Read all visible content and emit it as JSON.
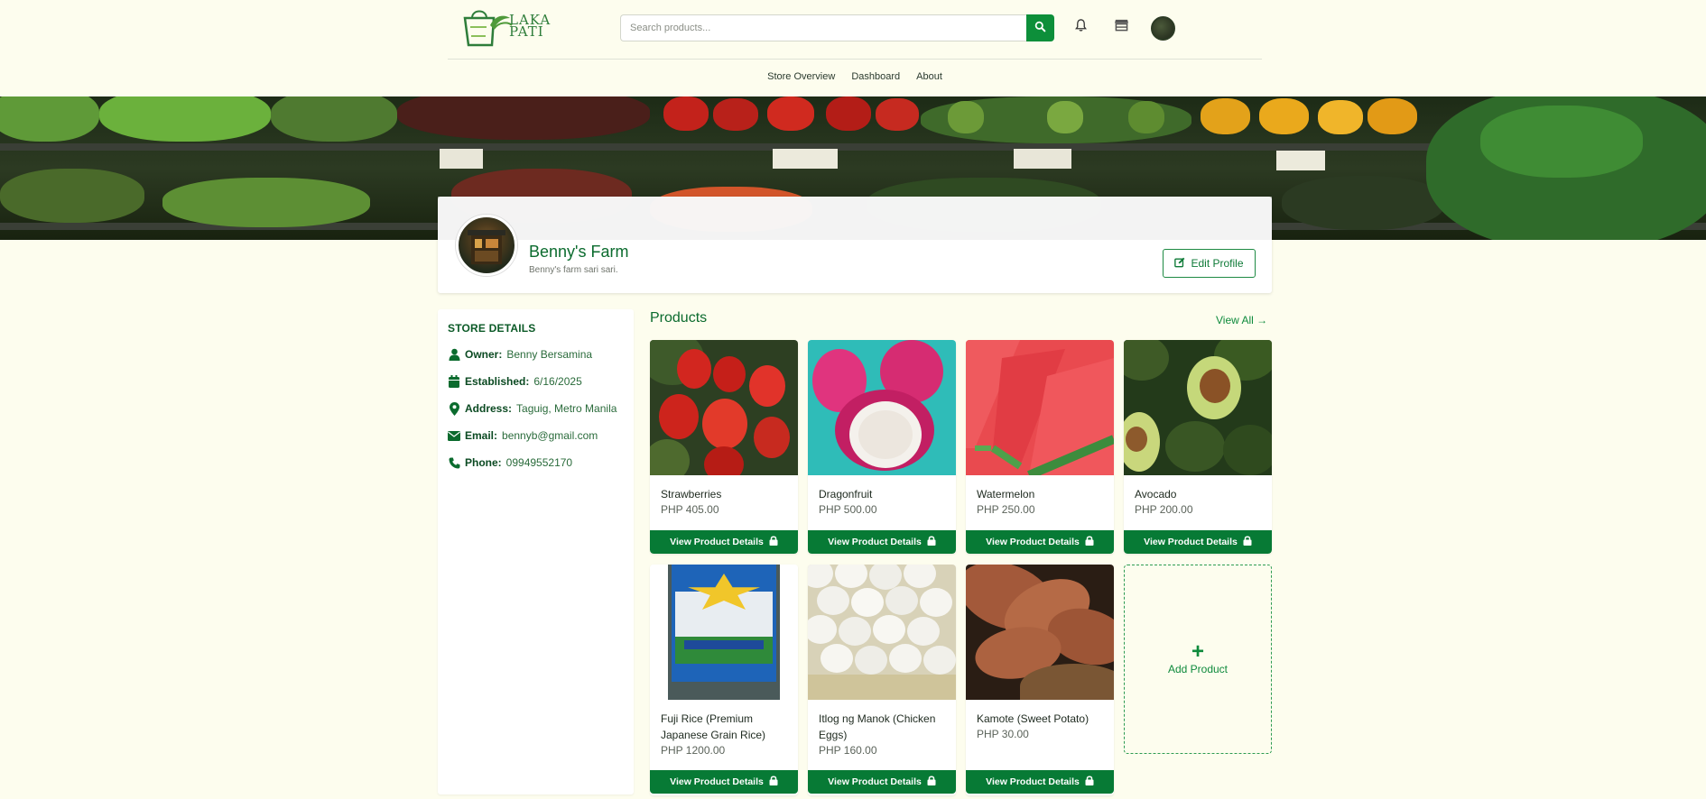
{
  "header": {
    "logo_text_line1": "LAKA",
    "logo_text_line2": "PATI",
    "search_placeholder": "Search products...",
    "icons": [
      "search-icon",
      "bell-icon",
      "store-icon",
      "avatar"
    ]
  },
  "nav": {
    "items": [
      "Store Overview",
      "Dashboard",
      "About"
    ]
  },
  "profile": {
    "store_name": "Benny's Farm",
    "description": "Benny's farm sari sari.",
    "edit_label": "Edit Profile"
  },
  "store_details": {
    "title": "STORE DETAILS",
    "rows": [
      {
        "label": "Owner:",
        "value": "Benny Bersamina",
        "icon": "user-icon"
      },
      {
        "label": "Established:",
        "value": "6/16/2025",
        "icon": "calendar-icon"
      },
      {
        "label": "Address:",
        "value": "Taguig, Metro Manila",
        "icon": "location-pin-icon"
      },
      {
        "label": "Email:",
        "value": "bennyb@gmail.com",
        "icon": "envelope-icon"
      },
      {
        "label": "Phone:",
        "value": "09949552170",
        "icon": "phone-icon"
      }
    ]
  },
  "products": {
    "title": "Products",
    "view_all": "View All →",
    "button_label": "View Product Details",
    "add_label": "Add Product",
    "items": [
      {
        "name": "Strawberries",
        "price": "PHP 405.00"
      },
      {
        "name": "Dragonfruit",
        "price": "PHP 500.00"
      },
      {
        "name": "Watermelon",
        "price": "PHP 250.00"
      },
      {
        "name": "Avocado",
        "price": "PHP 200.00"
      },
      {
        "name": "Fuji Rice (Premium Japanese Grain Rice)",
        "price": "PHP 1200.00"
      },
      {
        "name": "Itlog ng Manok (Chicken Eggs)",
        "price": "PHP 160.00"
      },
      {
        "name": "Kamote (Sweet Potato)",
        "price": "PHP 30.00"
      }
    ]
  },
  "colors": {
    "accent": "#077a35",
    "background": "#fdfdee",
    "title_green": "#0b6b2e"
  }
}
